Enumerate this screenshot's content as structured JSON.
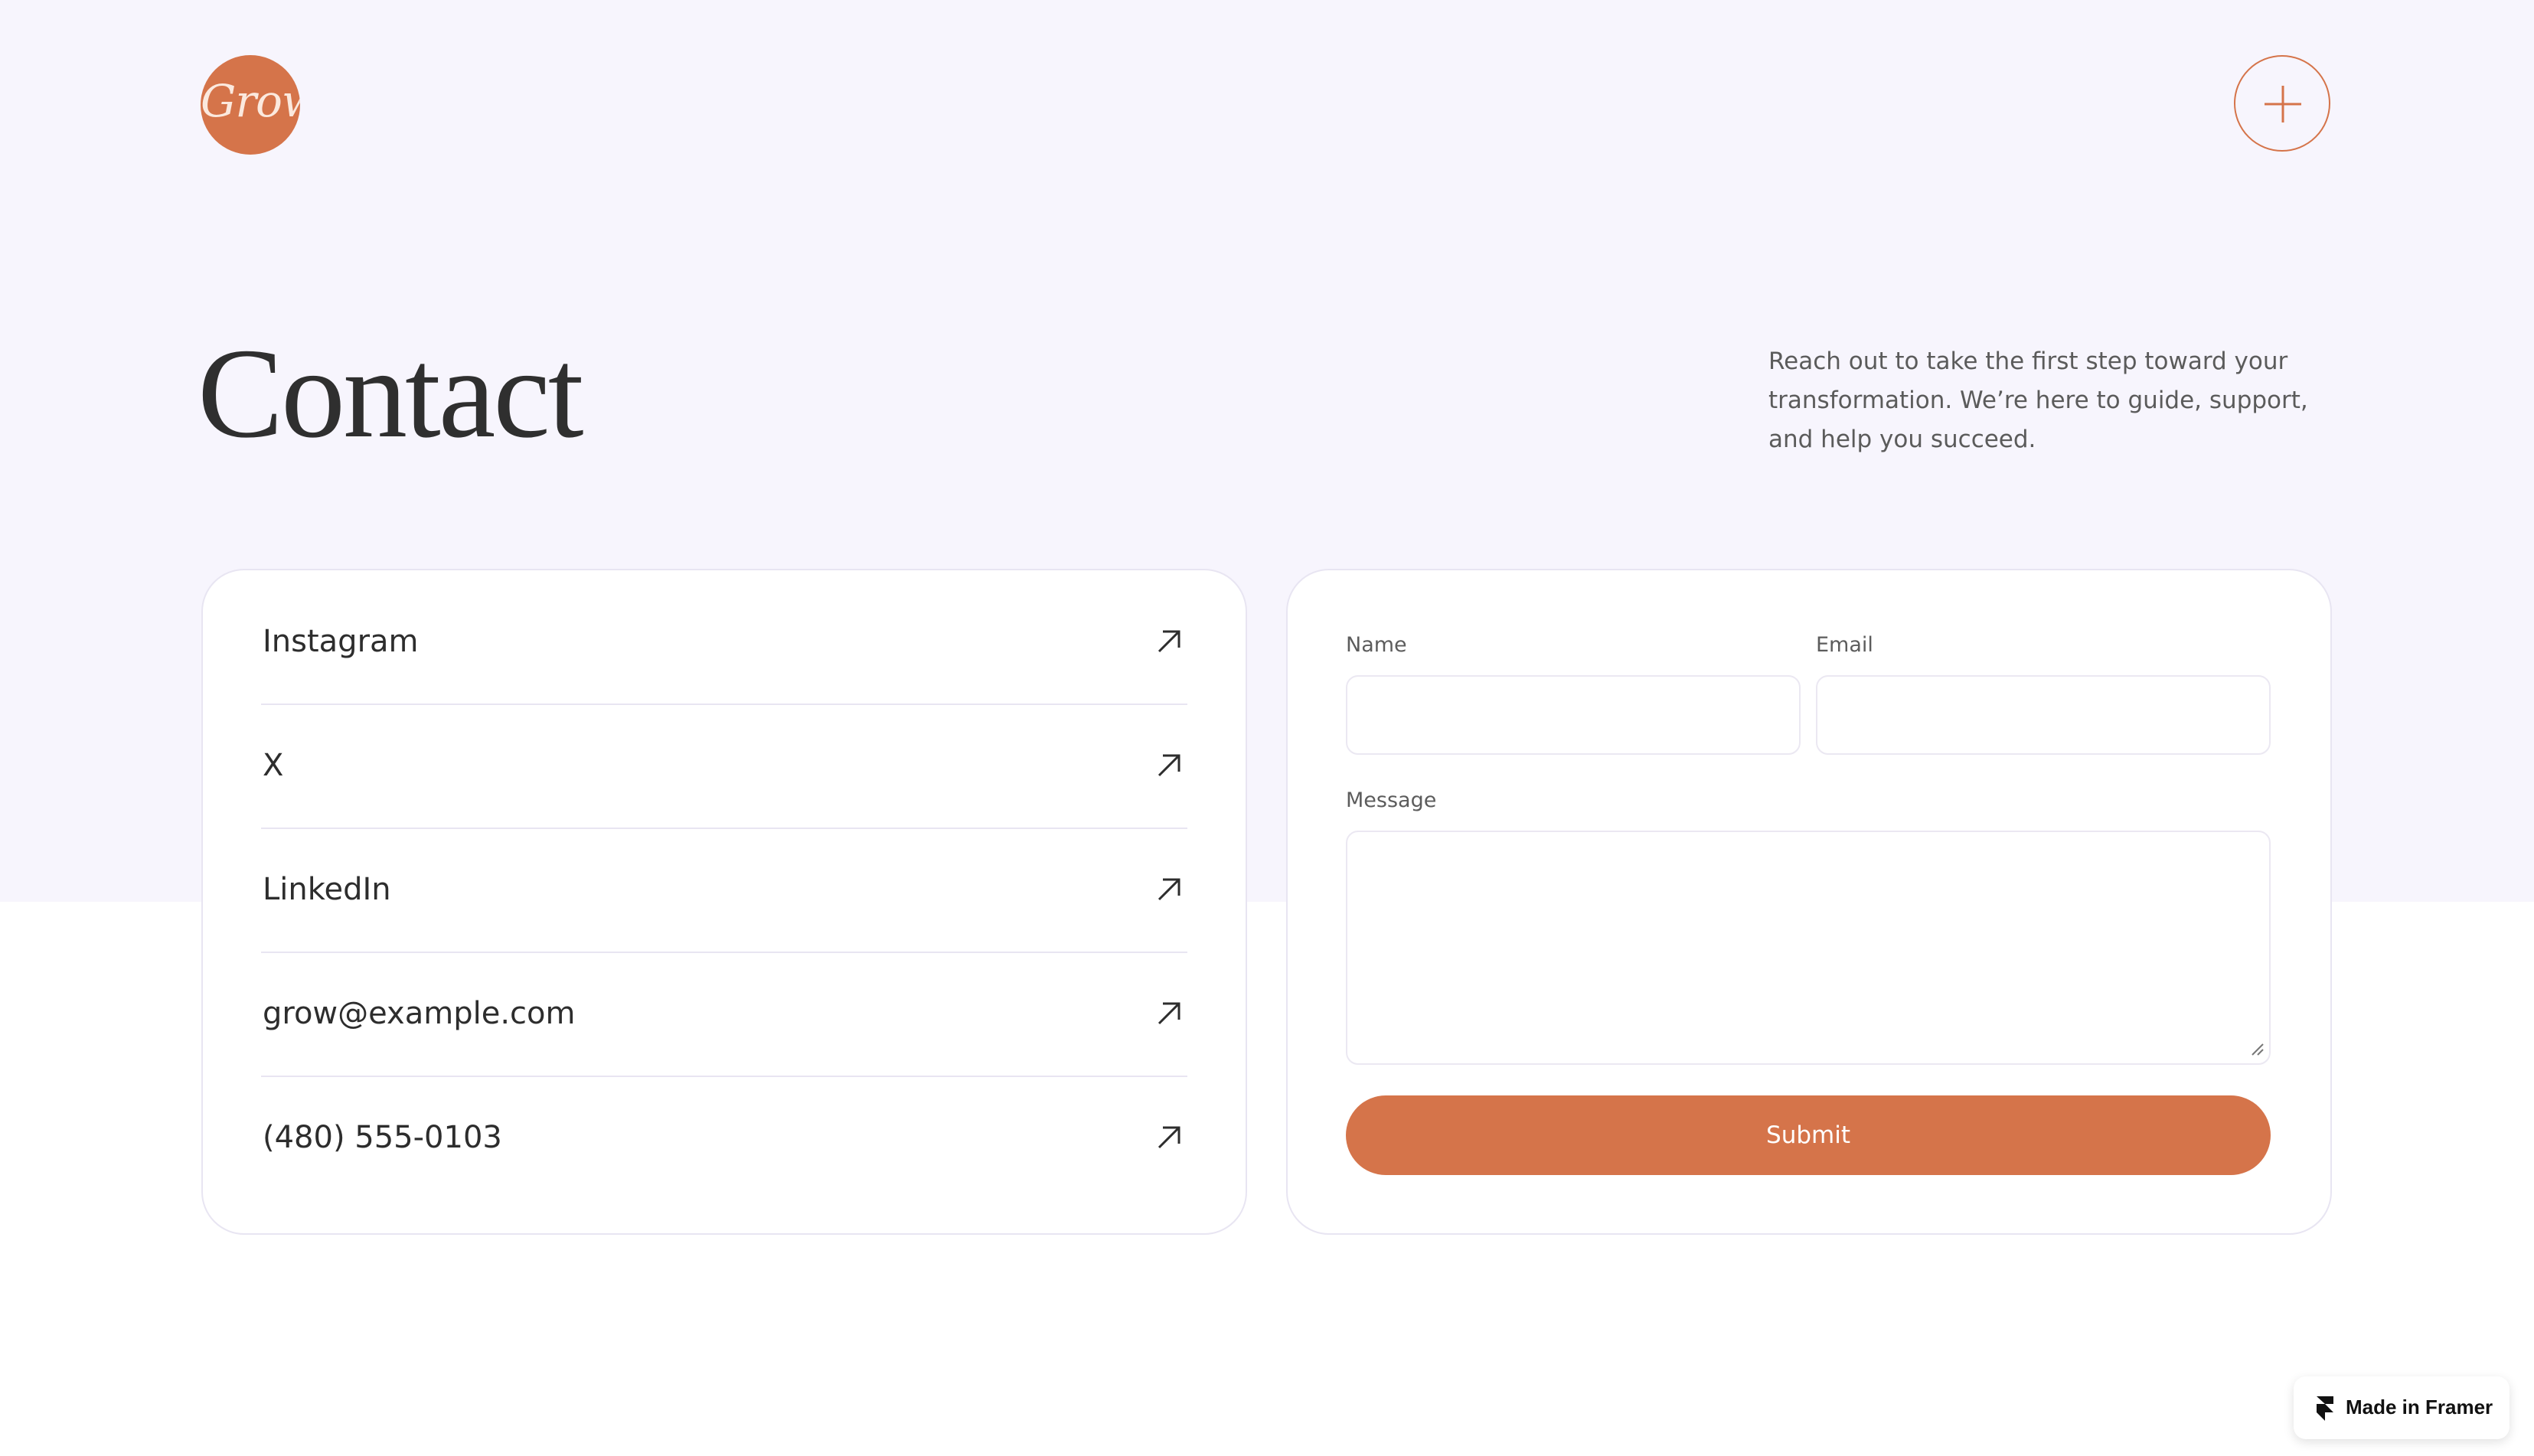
{
  "header": {
    "logo_text": "Grow",
    "menu_icon": "plus-icon"
  },
  "hero": {
    "title": "Contact",
    "intro": "Reach out to take the first step toward your transformation. We’re here to guide, support, and help you succeed."
  },
  "contact_links": [
    {
      "label": "Instagram",
      "icon": "arrow-up-right-icon"
    },
    {
      "label": "X",
      "icon": "arrow-up-right-icon"
    },
    {
      "label": "LinkedIn",
      "icon": "arrow-up-right-icon"
    },
    {
      "label": "grow@example.com",
      "icon": "arrow-up-right-icon"
    },
    {
      "label": "(480) 555-0103",
      "icon": "arrow-up-right-icon"
    }
  ],
  "form": {
    "name_label": "Name",
    "name_value": "",
    "email_label": "Email",
    "email_value": "",
    "message_label": "Message",
    "message_value": "",
    "submit_label": "Submit"
  },
  "badge": {
    "label": "Made in Framer",
    "icon": "framer-logo-icon"
  },
  "colors": {
    "accent": "#d5744a",
    "hero_background": "#f7f5fd",
    "text": "#2f2f2f",
    "border": "#e8e5f2"
  }
}
